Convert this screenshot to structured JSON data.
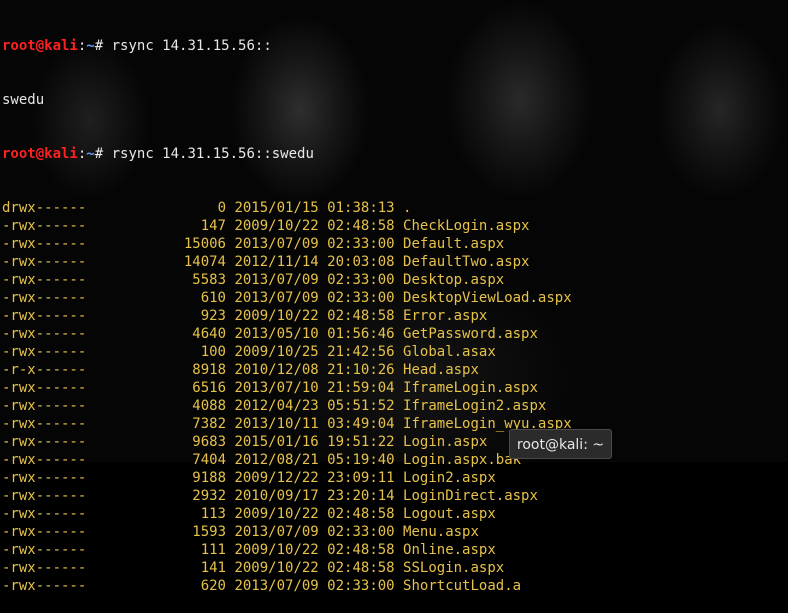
{
  "prompt": {
    "user": "root@kali",
    "colon": ":",
    "path": "~",
    "symbol": "#"
  },
  "commands": [
    " rsync 14.31.15.56::",
    " rsync 14.31.15.56::swedu"
  ],
  "module_output": "swedu",
  "listing": [
    {
      "perm": "drwx------",
      "size": "0",
      "date": "2015/01/15",
      "time": "01:38:13",
      "name": "."
    },
    {
      "perm": "-rwx------",
      "size": "147",
      "date": "2009/10/22",
      "time": "02:48:58",
      "name": "CheckLogin.aspx"
    },
    {
      "perm": "-rwx------",
      "size": "15006",
      "date": "2013/07/09",
      "time": "02:33:00",
      "name": "Default.aspx"
    },
    {
      "perm": "-rwx------",
      "size": "14074",
      "date": "2012/11/14",
      "time": "20:03:08",
      "name": "DefaultTwo.aspx"
    },
    {
      "perm": "-rwx------",
      "size": "5583",
      "date": "2013/07/09",
      "time": "02:33:00",
      "name": "Desktop.aspx"
    },
    {
      "perm": "-rwx------",
      "size": "610",
      "date": "2013/07/09",
      "time": "02:33:00",
      "name": "DesktopViewLoad.aspx"
    },
    {
      "perm": "-rwx------",
      "size": "923",
      "date": "2009/10/22",
      "time": "02:48:58",
      "name": "Error.aspx"
    },
    {
      "perm": "-rwx------",
      "size": "4640",
      "date": "2013/05/10",
      "time": "01:56:46",
      "name": "GetPassword.aspx"
    },
    {
      "perm": "-rwx------",
      "size": "100",
      "date": "2009/10/25",
      "time": "21:42:56",
      "name": "Global.asax"
    },
    {
      "perm": "-r-x------",
      "size": "8918",
      "date": "2010/12/08",
      "time": "21:10:26",
      "name": "Head.aspx"
    },
    {
      "perm": "-rwx------",
      "size": "6516",
      "date": "2013/07/10",
      "time": "21:59:04",
      "name": "IframeLogin.aspx"
    },
    {
      "perm": "-rwx------",
      "size": "4088",
      "date": "2012/04/23",
      "time": "05:51:52",
      "name": "IframeLogin2.aspx"
    },
    {
      "perm": "-rwx------",
      "size": "7382",
      "date": "2013/10/11",
      "time": "03:49:04",
      "name": "IframeLogin_wyu.aspx"
    },
    {
      "perm": "-rwx------",
      "size": "9683",
      "date": "2015/01/16",
      "time": "19:51:22",
      "name": "Login.aspx"
    },
    {
      "perm": "-rwx------",
      "size": "7404",
      "date": "2012/08/21",
      "time": "05:19:40",
      "name": "Login.aspx.bak"
    },
    {
      "perm": "-rwx------",
      "size": "9188",
      "date": "2009/12/22",
      "time": "23:09:11",
      "name": "Login2.aspx"
    },
    {
      "perm": "-rwx------",
      "size": "2932",
      "date": "2010/09/17",
      "time": "23:20:14",
      "name": "LoginDirect.aspx"
    },
    {
      "perm": "-rwx------",
      "size": "113",
      "date": "2009/10/22",
      "time": "02:48:58",
      "name": "Logout.aspx"
    },
    {
      "perm": "-rwx------",
      "size": "1593",
      "date": "2013/07/09",
      "time": "02:33:00",
      "name": "Menu.aspx"
    },
    {
      "perm": "-rwx------",
      "size": "111",
      "date": "2009/10/22",
      "time": "02:48:58",
      "name": "Online.aspx"
    },
    {
      "perm": "-rwx------",
      "size": "141",
      "date": "2009/10/22",
      "time": "02:48:58",
      "name": "SSLogin.aspx"
    },
    {
      "perm": "-rwx------",
      "size": "620",
      "date": "2013/07/09",
      "time": "02:33:00",
      "name": "ShortcutLoad.a"
    }
  ],
  "tooltip": "root@kali: ~",
  "colors": {
    "user": "#ff2020",
    "path": "#5c9cff",
    "listing": "#e6c24a",
    "background": "#000000"
  }
}
